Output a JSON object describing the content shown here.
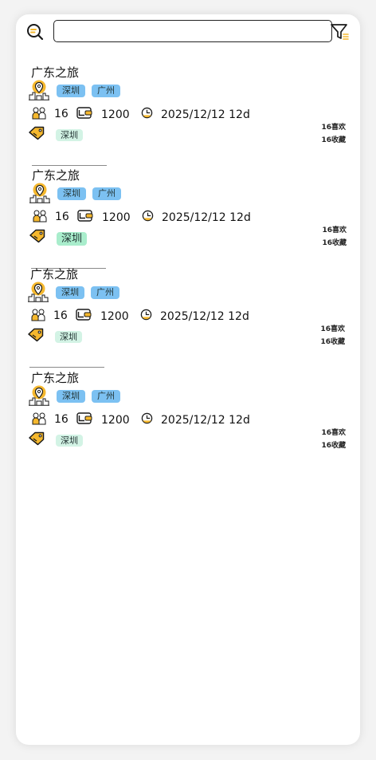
{
  "search": {
    "placeholder": ""
  },
  "trips": [
    {
      "title": "广东之旅",
      "tags": [
        "深圳",
        "广州"
      ],
      "people": "16",
      "budget": "1200",
      "date": "2025/12/12 12d",
      "destination": "深圳",
      "likes": "16喜欢",
      "collects": "16收藏"
    },
    {
      "title": "广东之旅",
      "tags": [
        "深圳",
        "广州"
      ],
      "people": "16",
      "budget": "1200",
      "date": "2025/12/12 12d",
      "destination": "深圳",
      "likes": "16喜欢",
      "collects": "16收藏"
    },
    {
      "title": "广东之旅",
      "tags": [
        "深圳",
        "广州"
      ],
      "people": "16",
      "budget": "1200",
      "date": "2025/12/12 12d",
      "destination": "深圳",
      "likes": "16喜欢",
      "collects": "16收藏"
    },
    {
      "title": "广东之旅",
      "tags": [
        "深圳",
        "广州"
      ],
      "people": "16",
      "budget": "1200",
      "date": "2025/12/12 12d",
      "destination": "深圳",
      "likes": "16喜欢",
      "collects": "16收藏"
    }
  ],
  "colors": {
    "accent": "#f5b82e",
    "tag_blue": "#7cc1f2",
    "tag_green": "#d3f3e5"
  },
  "icons": [
    "search-icon",
    "filter-icon",
    "city-pin-icon",
    "people-icon",
    "wallet-icon",
    "clock-icon",
    "price-tag-icon"
  ]
}
